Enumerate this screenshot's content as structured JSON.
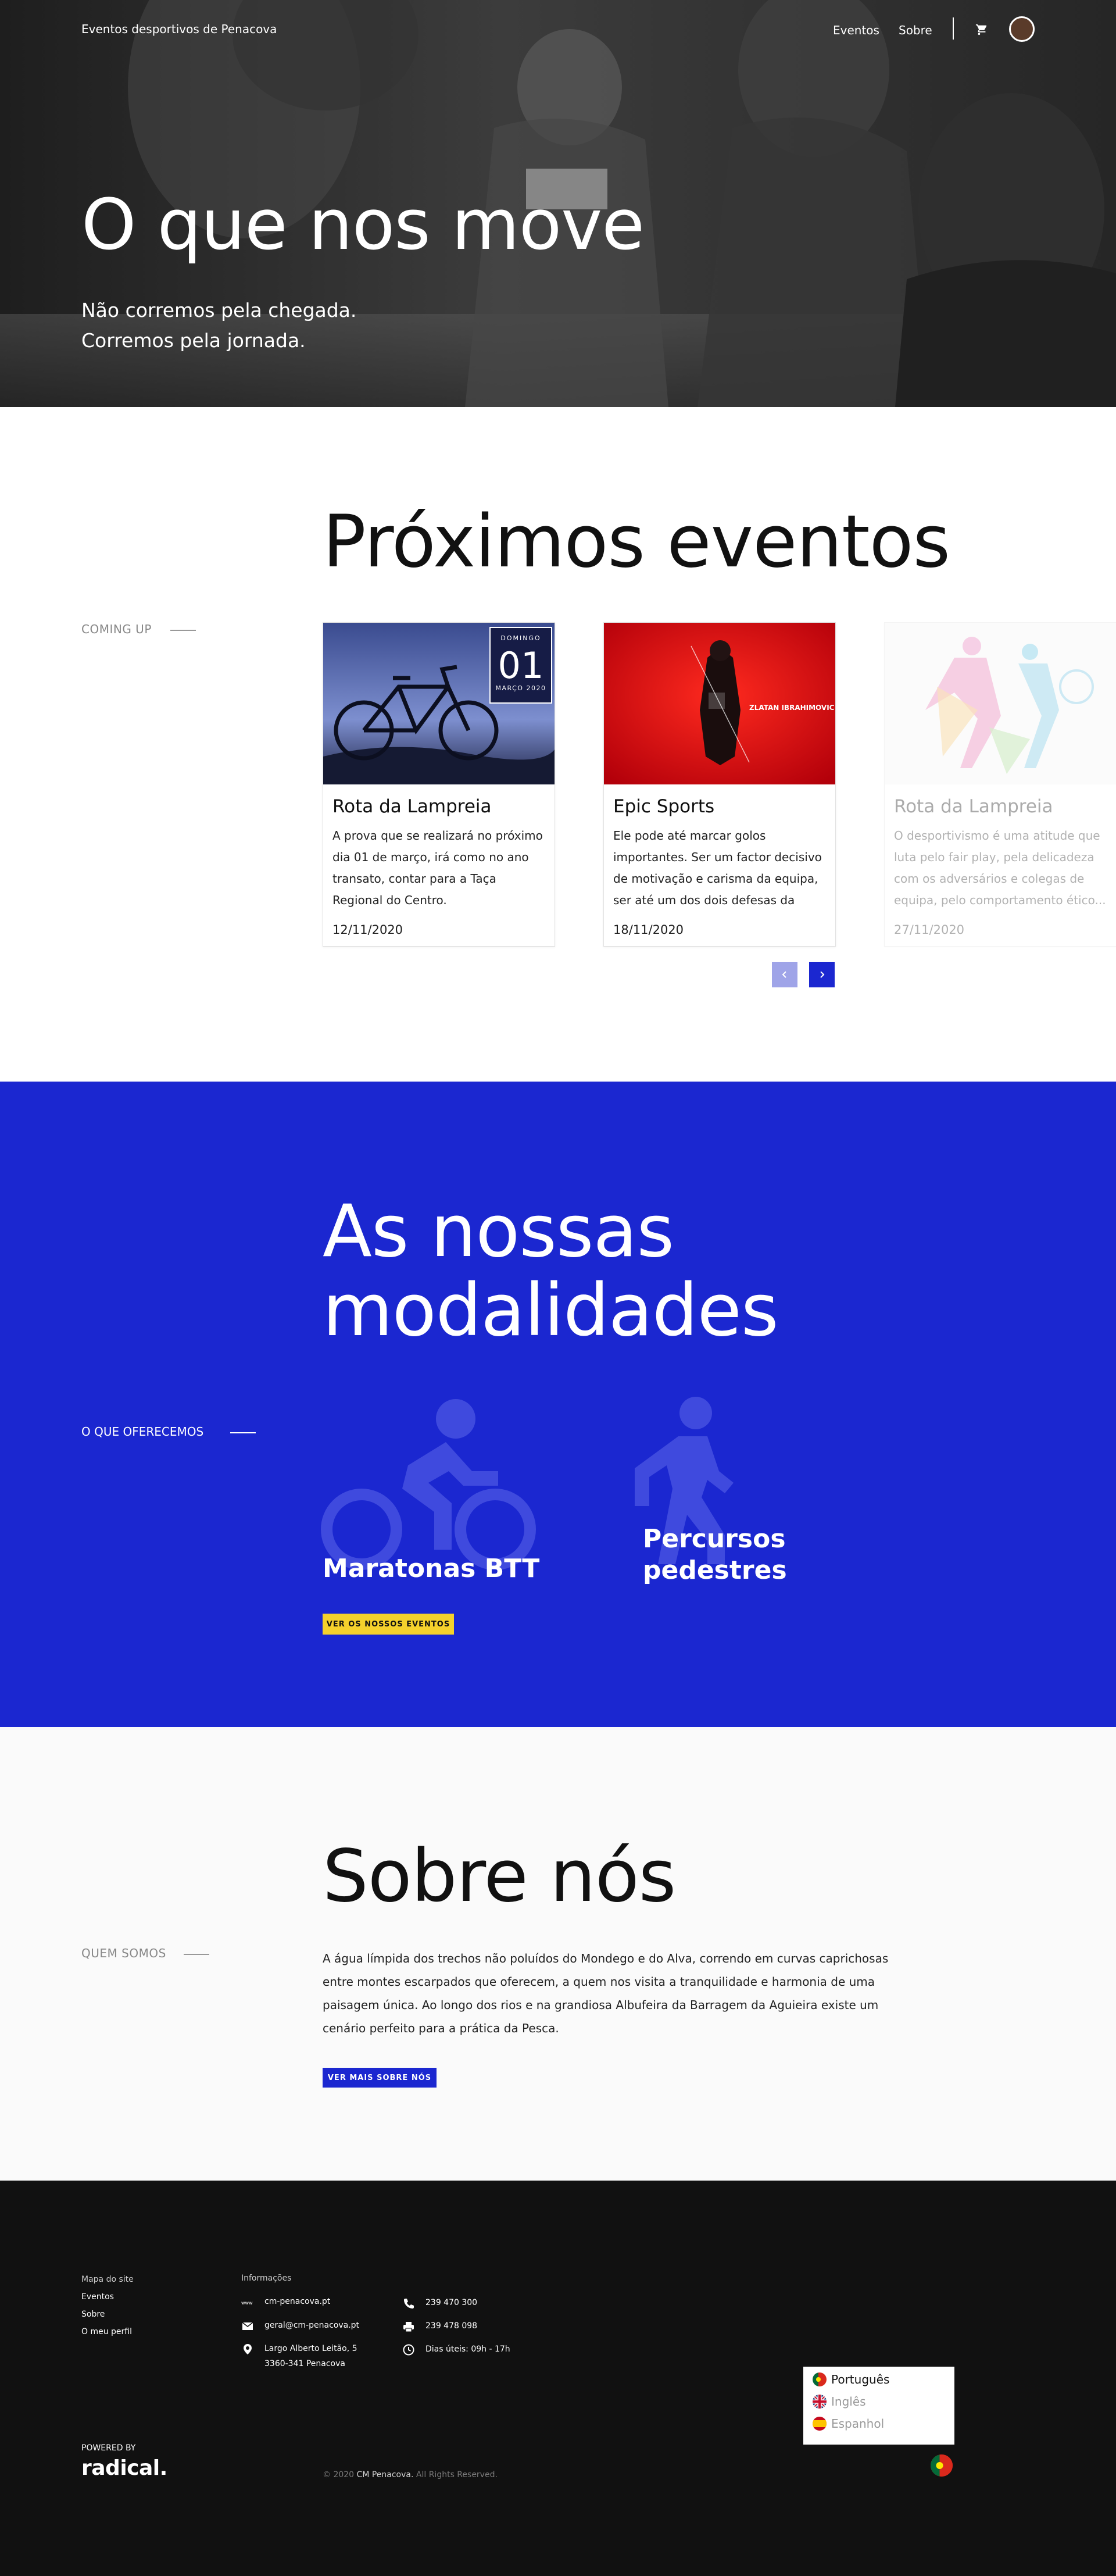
{
  "header": {
    "brand": "Eventos desportivos de Penacova",
    "nav": [
      "Eventos",
      "Sobre"
    ]
  },
  "hero": {
    "title": "O que nos move",
    "subtitle_line1": "Não corremos pela chegada.",
    "subtitle_line2": "Corremos pela jornada."
  },
  "events": {
    "title": "Próximos eventos",
    "side_label": "COMING UP",
    "cards": [
      {
        "title": "Rota da Lampreia",
        "description": "A prova que se realizará no próximo dia 01 de março, irá como no ano transato, contar para a Taça Regional do Centro.",
        "date": "12/11/2020",
        "poster_day_name": "DOMINGO",
        "poster_day": "01",
        "poster_month": "MARÇO 2020"
      },
      {
        "title": "Epic Sports",
        "description": "Ele pode até marcar golos importantes. Ser um factor decisivo de motivação e carisma da equipa, ser até um dos dois defesas da FIFA...",
        "date": "18/11/2020",
        "poster_text": "ZLATAN IBRAHIMOVIC"
      },
      {
        "title": "Rota da Lampreia",
        "description": "O desportivismo é uma atitude que luta pelo fair play, pela delicadeza com os adversários e colegas de equipa, pelo comportamento ético...",
        "date": "27/11/2020"
      }
    ]
  },
  "modalidades": {
    "title_line1": "As nossas",
    "title_line2": "modalidades",
    "side_label": "O QUE OFERECEMOS",
    "items": [
      {
        "label": "Maratonas BTT",
        "icon": "bike-icon"
      },
      {
        "label_line1": "Percursos",
        "label_line2": "pedestres",
        "icon": "walk-icon"
      }
    ],
    "button": "VER OS NOSSOS EVENTOS"
  },
  "sobre": {
    "title": "Sobre nós",
    "side_label": "QUEM SOMOS",
    "text": "A água límpida dos trechos não poluídos do Mondego e do Alva, correndo em curvas caprichosas entre montes escarpados que oferecem, a quem nos visita a tranquilidade e harmonia de uma paisagem única. Ao longo dos rios e na grandiosa Albufeira da Barragem da Aguieira existe um cenário perfeito para a prática da Pesca.",
    "button": "VER MAIS SOBRE NÓS"
  },
  "footer": {
    "sitemap_title": "Mapa do site",
    "sitemap": [
      "Eventos",
      "Sobre",
      "O meu perfil"
    ],
    "info_title": "Informações",
    "website": "cm-penacova.pt",
    "email": "geral@cm-penacova.pt",
    "address_line1": "Largo Alberto Leitão, 5",
    "address_line2": "3360-341 Penacova",
    "phone": "239 470 300",
    "fax": "239 478 098",
    "hours": "Dias úteis: 09h - 17h",
    "languages": [
      "Português",
      "Inglês",
      "Espanhol"
    ],
    "powered_by": "POWERED BY",
    "powered_brand": "radical.",
    "copyright_prefix": "© 2020",
    "copyright_brand": "CM Penacova.",
    "copyright_suffix": "All Rights Reserved."
  },
  "colors": {
    "accent_blue": "#1b27d0",
    "accent_yellow": "#f5d12c",
    "footer_bg": "#111111"
  }
}
